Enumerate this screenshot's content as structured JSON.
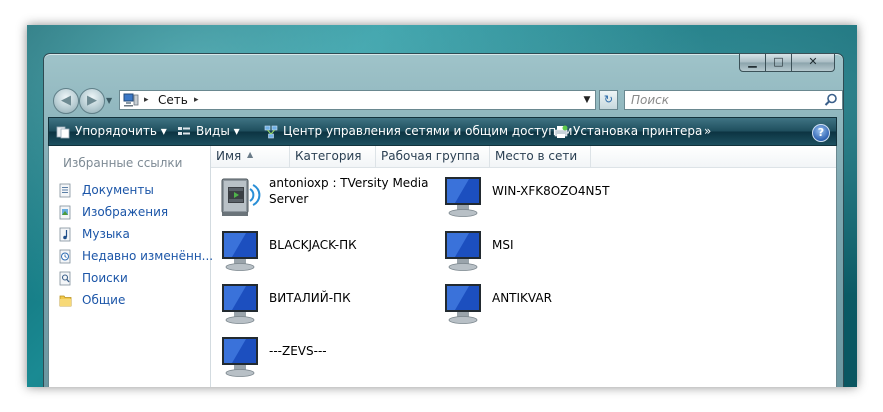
{
  "window": {
    "caption_buttons": {
      "minimize": "▁",
      "maximize": "□",
      "close": "✕"
    }
  },
  "nav": {
    "back_glyph": "◀",
    "forward_glyph": "▶",
    "history_dropdown": "▼",
    "address_segments": [
      "Сеть"
    ],
    "address_separator": "▸",
    "address_dropdown": "▼",
    "refresh_glyph": "↻"
  },
  "search": {
    "placeholder": "Поиск"
  },
  "toolbar": {
    "organize": "Упорядочить ▾",
    "views": "Виды ▾",
    "network_center": "Центр управления сетями и общим доступом",
    "add_printer": "Установка принтера",
    "more": "»",
    "help": "?"
  },
  "favorites": {
    "title": "Избранные ссылки",
    "items": [
      {
        "label": "Документы",
        "icon": "documents-icon"
      },
      {
        "label": "Изображения",
        "icon": "pictures-icon"
      },
      {
        "label": "Музыка",
        "icon": "music-icon"
      },
      {
        "label": "Недавно изменённ...",
        "icon": "recent-icon"
      },
      {
        "label": "Поиски",
        "icon": "searches-icon"
      },
      {
        "label": "Общие",
        "icon": "public-folder-icon"
      }
    ]
  },
  "columns": {
    "name": "Имя",
    "category": "Категория",
    "workgroup": "Рабочая группа",
    "network_location": "Место в сети",
    "sort_indicator": "▲"
  },
  "items": [
    {
      "name": "antonioxp : TVersity Media Server",
      "icon": "media-server-icon"
    },
    {
      "name": "WIN-XFK8OZO4N5T",
      "icon": "computer-icon"
    },
    {
      "name": "BLACKJACK-ПК",
      "icon": "computer-icon"
    },
    {
      "name": "MSI",
      "icon": "computer-icon"
    },
    {
      "name": "ВИТАЛИЙ-ПК",
      "icon": "computer-icon"
    },
    {
      "name": "ANTIKVAR",
      "icon": "computer-icon"
    },
    {
      "name": "---ZEVS---",
      "icon": "computer-icon"
    }
  ],
  "colors": {
    "link_blue": "#1c56a8",
    "toolbar_dark": "#0c3442",
    "frame_teal": "#7fa9b2"
  }
}
